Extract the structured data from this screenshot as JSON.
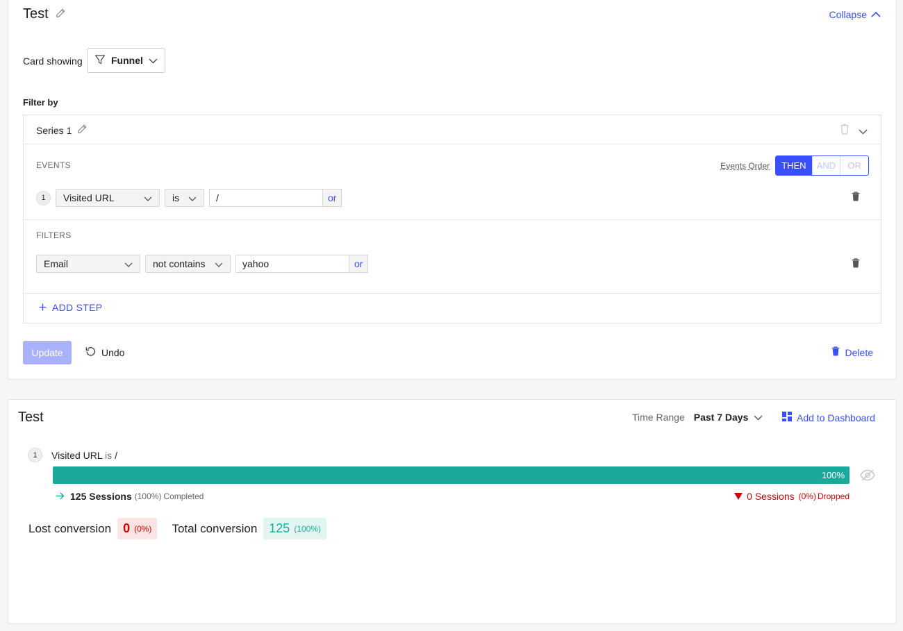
{
  "editor": {
    "title": "Test",
    "collapse_label": "Collapse",
    "card_showing_label": "Card showing",
    "card_type": "Funnel",
    "filter_by_label": "Filter by",
    "series": {
      "name": "Series 1",
      "events_label": "EVENTS",
      "events_order_label": "Events Order",
      "order_options": [
        "THEN",
        "AND",
        "OR"
      ],
      "selected_order": "THEN",
      "events": [
        {
          "index": "1",
          "field": "Visited URL",
          "operator": "is",
          "value": "/",
          "or_label": "or"
        }
      ],
      "filters_label": "FILTERS",
      "filters": [
        {
          "field": "Email",
          "operator": "not contains",
          "value": "yahoo",
          "or_label": "or"
        }
      ],
      "add_step_label": "ADD STEP"
    },
    "update_label": "Update",
    "undo_label": "Undo",
    "delete_label": "Delete"
  },
  "result": {
    "title": "Test",
    "time_range_label": "Time Range",
    "time_range_value": "Past 7 Days",
    "add_to_dashboard_label": "Add to Dashboard",
    "stage": {
      "index": "1",
      "field": "Visited URL",
      "operator": "is",
      "value": "/",
      "percent": "100%",
      "percent_value": 100,
      "completed_sessions": "125 Sessions",
      "completed_pct": "(100%)",
      "completed_label": "Completed",
      "dropped_sessions": "0 Sessions",
      "dropped_pct": "(0%)",
      "dropped_label": "Dropped"
    },
    "lost_conversion_label": "Lost conversion",
    "lost_conversion_value": "0",
    "lost_conversion_pct": "(0%)",
    "total_conversion_label": "Total conversion",
    "total_conversion_value": "125",
    "total_conversion_pct": "(100%)"
  },
  "colors": {
    "accent": "#394EFF",
    "teal": "#1aaa9b",
    "danger": "#cc0000"
  }
}
